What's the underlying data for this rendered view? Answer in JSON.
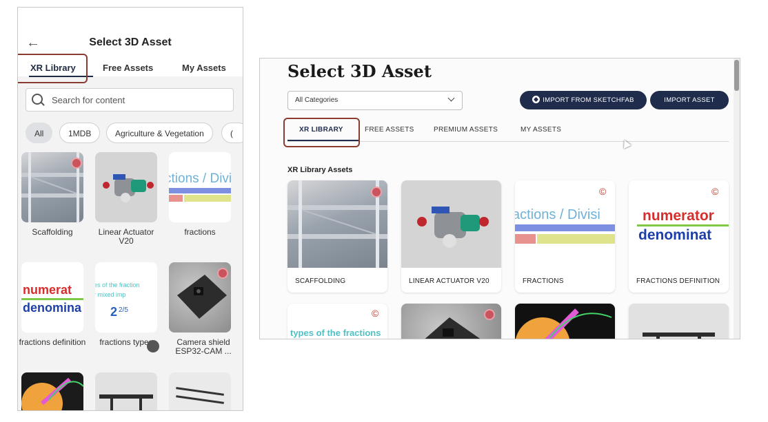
{
  "mobile": {
    "title": "Select 3D Asset",
    "tabs": [
      {
        "label": "XR Library"
      },
      {
        "label": "Free Assets"
      },
      {
        "label": "My Assets"
      }
    ],
    "search_placeholder": "Search for content",
    "chips": [
      {
        "label": "All"
      },
      {
        "label": "1MDB"
      },
      {
        "label": "Agriculture & Vegetation"
      }
    ],
    "items": [
      {
        "label": "Scaffolding",
        "icon": "scaffolding-thumbnail"
      },
      {
        "label": "Linear Actuator V20",
        "icon": "actuator-thumbnail"
      },
      {
        "label": "fractions",
        "icon": "fractions-thumbnail"
      },
      {
        "label": "fractions definition",
        "icon": "fractions-definition-thumbnail"
      },
      {
        "label": "fractions types",
        "icon": "fractions-types-thumbnail"
      },
      {
        "label": "Camera shield ESP32-CAM ...",
        "icon": "camera-shield-thumbnail"
      }
    ],
    "thumb_texts": {
      "fractions": "ctions / Divi",
      "numerator": "numerat",
      "denominator": "denomina",
      "types_line1": "es of the fraction",
      "types_line2": "r    mixed    imp",
      "types_mixed": "2",
      "types_fraction": "2/5"
    }
  },
  "desktop": {
    "title": "Select 3D Asset",
    "category_select": "All Categories",
    "buttons": {
      "sketchfab": "IMPORT FROM SKETCHFAB",
      "import": "IMPORT ASSET"
    },
    "tabs": [
      {
        "label": "XR LIBRARY"
      },
      {
        "label": "FREE ASSETS"
      },
      {
        "label": "PREMIUM ASSETS"
      },
      {
        "label": "MY ASSETS"
      }
    ],
    "section_title": "XR Library Assets",
    "cards": [
      {
        "label": "SCAFFOLDING"
      },
      {
        "label": "LINEAR ACTUATOR V20"
      },
      {
        "label": "FRACTIONS"
      },
      {
        "label": "FRACTIONS DEFINITION"
      }
    ],
    "thumb_texts": {
      "fractions": "actions / Divisi",
      "numerator": "numerator",
      "denominator": "denominat",
      "types": "types of the fractions",
      "copyright": "©"
    }
  },
  "colors": {
    "accent_navy": "#1f2c4c",
    "highlight_border": "#8a3a2e"
  }
}
